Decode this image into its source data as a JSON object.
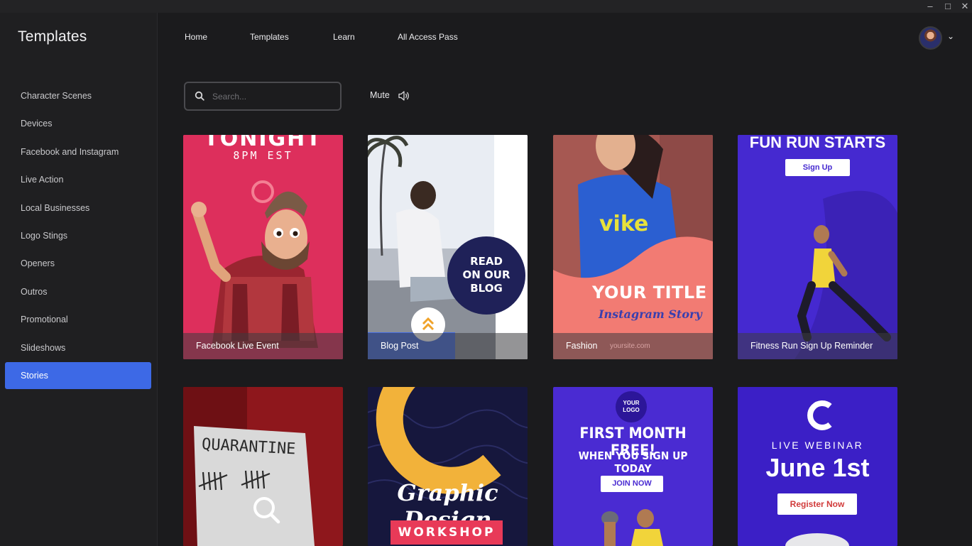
{
  "window": {
    "minimize_glyph": "–",
    "maximize_glyph": "□",
    "close_glyph": "✕"
  },
  "sidebar": {
    "title": "Templates",
    "items": [
      {
        "label": "Character Scenes"
      },
      {
        "label": "Devices"
      },
      {
        "label": "Facebook and Instagram"
      },
      {
        "label": "Live Action"
      },
      {
        "label": "Local Businesses"
      },
      {
        "label": "Logo Stings"
      },
      {
        "label": "Openers"
      },
      {
        "label": "Outros"
      },
      {
        "label": "Promotional"
      },
      {
        "label": "Slideshows"
      },
      {
        "label": "Stories",
        "active": true
      }
    ]
  },
  "nav": {
    "home": "Home",
    "templates": "Templates",
    "learn": "Learn",
    "all_access": "All Access Pass",
    "chevron": "⌄"
  },
  "search": {
    "placeholder": "Search...",
    "value": ""
  },
  "mute": {
    "label": "Mute"
  },
  "accent_color": "#3d69e6",
  "cards": [
    {
      "caption": "Facebook Live Event",
      "top_text": "TONIGHT",
      "sub_text": "8PM EST"
    },
    {
      "caption": "Blog Post",
      "circle_text": [
        "READ",
        "ON OUR",
        "BLOG"
      ]
    },
    {
      "caption": "Fashion",
      "title": "YOUR TITLE",
      "subtitle": "Instagram Story",
      "footer": "yoursite.com"
    },
    {
      "caption": "Fitness Run Sign Up Reminder",
      "title": "FUN RUN STARTS",
      "button": "Sign Up"
    },
    {
      "note_title": "QUARANTINE"
    },
    {
      "title": "Graphic Design",
      "banner": "WORKSHOP"
    },
    {
      "logo": [
        "YOUR",
        "LOGO"
      ],
      "title": "FIRST MONTH FREE!",
      "subtitle": "WHEN YOU SIGN UP TODAY",
      "button": "JOIN NOW"
    },
    {
      "kicker": "LIVE WEBINAR",
      "title": "June 1st",
      "button": "Register Now"
    }
  ]
}
